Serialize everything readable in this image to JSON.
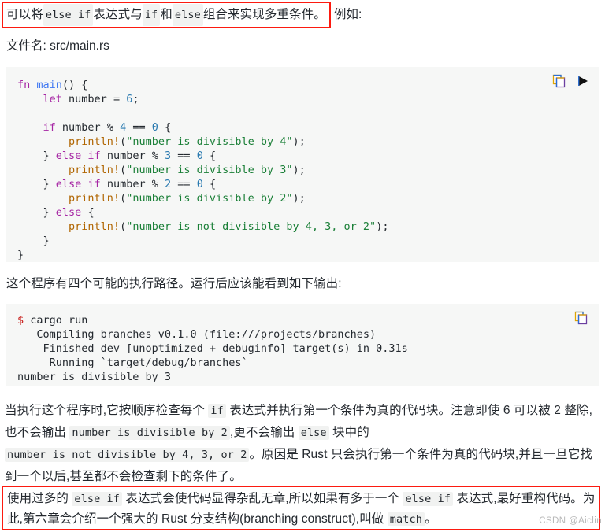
{
  "intro": {
    "highlighted_prefix": "可以将 ",
    "code_1": "else if",
    "mid_1": " 表达式与 ",
    "code_2": "if",
    "mid_2": " 和 ",
    "code_3": "else",
    "mid_3": " 组合来实现多重条件。",
    "trailing": "例如:"
  },
  "filename": {
    "label": "文件名: src/main.rs"
  },
  "code_block": {
    "language": "rust",
    "copy_icon": "copy-icon",
    "run_icon": "play-icon",
    "lines": [
      "fn main() {",
      "    let number = 6;",
      "",
      "    if number % 4 == 0 {",
      "        println!(\"number is divisible by 4\");",
      "    } else if number % 3 == 0 {",
      "        println!(\"number is divisible by 3\");",
      "    } else if number % 2 == 0 {",
      "        println!(\"number is divisible by 2\");",
      "    } else {",
      "        println!(\"number is not divisible by 4, 3, or 2\");",
      "    }",
      "}"
    ]
  },
  "mid_paragraph": {
    "text": "这个程序有四个可能的执行路径。运行后应该能看到如下输出:"
  },
  "output_block": {
    "copy_icon": "copy-icon",
    "prompt": "$",
    "command": " cargo run",
    "lines": [
      "   Compiling branches v0.1.0 (file:///projects/branches)",
      "    Finished dev [unoptimized + debuginfo] target(s) in 0.31s",
      "     Running `target/debug/branches`",
      "number is divisible by 3"
    ]
  },
  "explanation": {
    "seg_1": "当执行这个程序时,它按顺序检查每个 ",
    "code_1": "if",
    "seg_2": " 表达式并执行第一个条件为真的代码块。注意即使 6 可以被 2 整除,也不会输出 ",
    "code_2": "number is divisible by 2",
    "seg_3": ",更不会输出 ",
    "code_3": "else",
    "seg_4": " 块中的 ",
    "code_4": "number is not divisible by 4, 3, or 2",
    "seg_5": "。原因是 Rust 只会执行第一个条件为真的代码块,并且一旦它找到一个以后,甚至都不会检查剩下的条件了。"
  },
  "conclusion": {
    "seg_1": "使用过多的 ",
    "code_1": "else if",
    "seg_2": " 表达式会使代码显得杂乱无章,所以如果有多于一个 ",
    "code_2": "else if",
    "seg_3": " 表达式,最好重构代码。为此,第六章会介绍一个强大的 Rust 分支结构(branching construct),叫做 ",
    "code_3": "match",
    "seg_4": "。"
  },
  "watermark": {
    "text": "CSDN @Aiclin"
  },
  "colors": {
    "highlight_border": "#fc1a10",
    "code_background": "#f6f7f6",
    "keyword": "#a626a4",
    "string": "#1a7f37",
    "macro": "#b06500",
    "number": "#2a7ab0",
    "function": "#4078f2",
    "prompt": "#c9211e"
  }
}
